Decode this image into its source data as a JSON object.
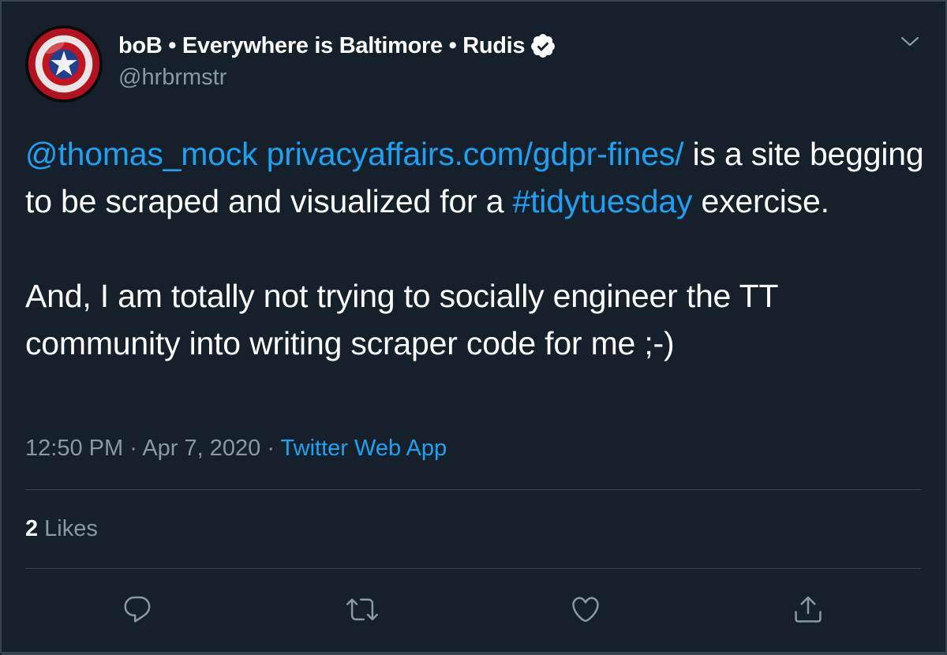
{
  "author": {
    "name": "boB • Everywhere is Baltimore • Rudis",
    "handle": "@hrbrmstr",
    "verified_icon": "verified-badge-icon",
    "avatar_icon": "shield-avatar"
  },
  "tweet": {
    "mention": "@thomas_mock",
    "url": "privacyaffairs.com/gdpr-fines/",
    "text_after_url": " is a site begging to be scraped and visualized for a ",
    "hashtag": "#tidytuesday",
    "text_after_hashtag": " exercise.",
    "paragraph2": "And, I am totally not trying to socially engineer the TT community into writing scraper code for me ;-)"
  },
  "meta": {
    "time": "12:50 PM",
    "separator": " · ",
    "date": "Apr 7, 2020",
    "source": "Twitter Web App"
  },
  "stats": {
    "likes_count": "2",
    "likes_label": "Likes"
  },
  "actions": {
    "reply_icon": "reply-icon",
    "retweet_icon": "retweet-icon",
    "like_icon": "heart-icon",
    "share_icon": "share-icon"
  },
  "colors": {
    "background": "#15202b",
    "link": "#1da1f2",
    "secondary_text": "#8899a6",
    "divider": "#38444d"
  }
}
